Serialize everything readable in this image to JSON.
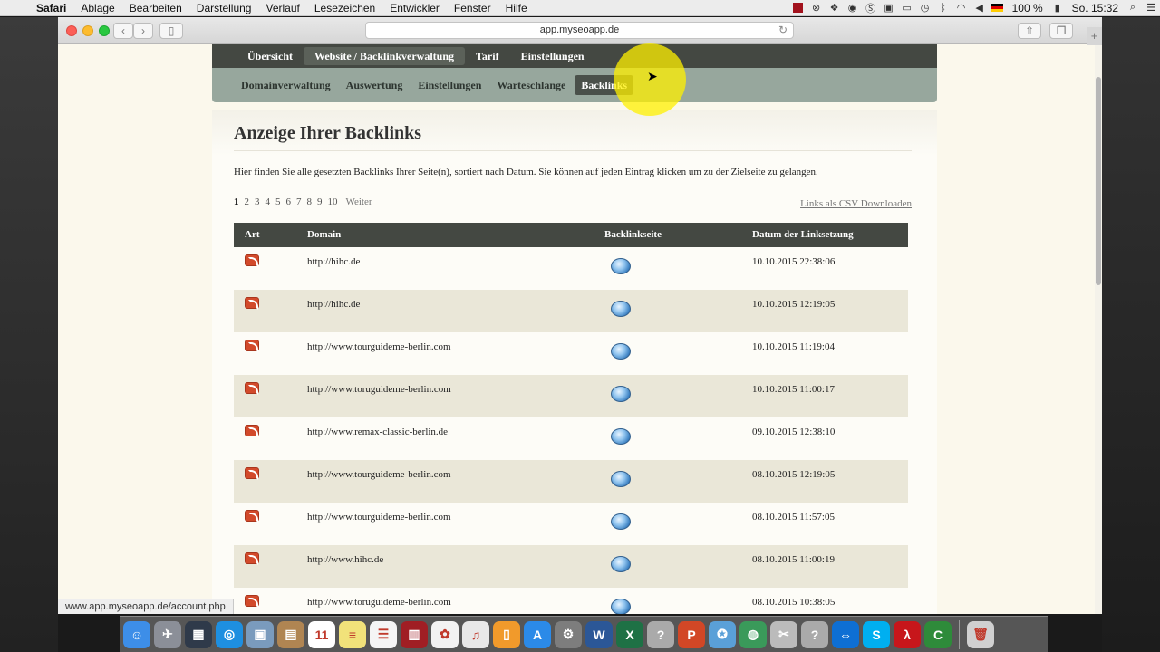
{
  "menubar": {
    "app_name": "Safari",
    "items": [
      "Ablage",
      "Bearbeiten",
      "Darstellung",
      "Verlauf",
      "Lesezeichen",
      "Entwickler",
      "Fenster",
      "Hilfe"
    ],
    "battery": "100 %",
    "clock": "So. 15:32"
  },
  "browser": {
    "url": "app.myseoapp.de",
    "status_url": "www.app.myseoapp.de/account.php"
  },
  "mainnav": {
    "items": [
      "Übersicht",
      "Website / Backlinkverwaltung",
      "Tarif",
      "Einstellungen"
    ],
    "active_index": 1
  },
  "subnav": {
    "items": [
      "Domainverwaltung",
      "Auswertung",
      "Einstellungen",
      "Warteschlange",
      "Backlinks"
    ],
    "active_index": 4
  },
  "main": {
    "title": "Anzeige Ihrer Backlinks",
    "intro": "Hier finden Sie alle gesetzten Backlinks Ihrer Seite(n), sortiert nach Datum. Sie können auf jeden Eintrag klicken um zu der Zielseite zu gelangen.",
    "pagination": [
      "1",
      "2",
      "3",
      "4",
      "5",
      "6",
      "7",
      "8",
      "9",
      "10"
    ],
    "pagination_current": "1",
    "next_label": "Weiter",
    "csv_link": "Links als CSV Downloaden"
  },
  "table": {
    "headers": {
      "art": "Art",
      "domain": "Domain",
      "page": "Backlinkseite",
      "date": "Datum der Linksetzung"
    },
    "rows": [
      {
        "domain": "http://hihc.de",
        "date": "10.10.2015 22:38:06"
      },
      {
        "domain": "http://hihc.de",
        "date": "10.10.2015 12:19:05"
      },
      {
        "domain": "http://www.tourguideme-berlin.com",
        "date": "10.10.2015 11:19:04"
      },
      {
        "domain": "http://www.toruguideme-berlin.com",
        "date": "10.10.2015 11:00:17"
      },
      {
        "domain": "http://www.remax-classic-berlin.de",
        "date": "09.10.2015 12:38:10"
      },
      {
        "domain": "http://www.tourguideme-berlin.com",
        "date": "08.10.2015 12:19:05"
      },
      {
        "domain": "http://www.tourguideme-berlin.com",
        "date": "08.10.2015 11:57:05"
      },
      {
        "domain": "http://www.hihc.de",
        "date": "08.10.2015 11:00:19"
      },
      {
        "domain": "http://www.toruguideme-berlin.com",
        "date": "08.10.2015 10:38:05"
      }
    ]
  },
  "dock": {
    "apps": [
      {
        "name": "finder-icon",
        "color": "#3d8ee8",
        "glyph": "☺"
      },
      {
        "name": "launchpad-icon",
        "color": "#8b8f98",
        "glyph": "✈"
      },
      {
        "name": "mission-control-icon",
        "color": "#2f3a4a",
        "glyph": "▦"
      },
      {
        "name": "safari-icon",
        "color": "#1e8fe0",
        "glyph": "◎"
      },
      {
        "name": "preview-icon",
        "color": "#7a9bbd",
        "glyph": "▣"
      },
      {
        "name": "contacts-icon",
        "color": "#b08552",
        "glyph": "▤"
      },
      {
        "name": "calendar-icon",
        "color": "#ffffff",
        "glyph": "11"
      },
      {
        "name": "notes-icon",
        "color": "#f1e27a",
        "glyph": "≡"
      },
      {
        "name": "reminders-icon",
        "color": "#f5f5f5",
        "glyph": "☰"
      },
      {
        "name": "photo-booth-icon",
        "color": "#a01e24",
        "glyph": "▥"
      },
      {
        "name": "photos-icon",
        "color": "#f2f2f2",
        "glyph": "✿"
      },
      {
        "name": "itunes-icon",
        "color": "#e8e8e8",
        "glyph": "♫"
      },
      {
        "name": "ibooks-icon",
        "color": "#f19a2b",
        "glyph": "▯"
      },
      {
        "name": "app-store-icon",
        "color": "#2b8ae8",
        "glyph": "A"
      },
      {
        "name": "system-preferences-icon",
        "color": "#7d7d7d",
        "glyph": "⚙"
      },
      {
        "name": "word-icon",
        "color": "#2b5797",
        "glyph": "W"
      },
      {
        "name": "excel-icon",
        "color": "#1e7145",
        "glyph": "X"
      },
      {
        "name": "unknown-app-icon",
        "color": "#aaaaaa",
        "glyph": "?"
      },
      {
        "name": "powerpoint-icon",
        "color": "#d24726",
        "glyph": "P"
      },
      {
        "name": "messenger-icon",
        "color": "#5aa0d8",
        "glyph": "✪"
      },
      {
        "name": "globe-icon",
        "color": "#3a9a5a",
        "glyph": "◍"
      },
      {
        "name": "utility-icon",
        "color": "#bbbbbb",
        "glyph": "✂"
      },
      {
        "name": "unknown-app-2-icon",
        "color": "#aaaaaa",
        "glyph": "?"
      },
      {
        "name": "teamviewer-icon",
        "color": "#0e6fd4",
        "glyph": "⇔"
      },
      {
        "name": "skype-icon",
        "color": "#00aff0",
        "glyph": "S"
      },
      {
        "name": "acrobat-icon",
        "color": "#c7161b",
        "glyph": "λ"
      },
      {
        "name": "camtasia-icon",
        "color": "#2e8b3a",
        "glyph": "C"
      },
      {
        "name": "trash-icon",
        "color": "#d0d0d0",
        "glyph": "🗑"
      }
    ]
  }
}
